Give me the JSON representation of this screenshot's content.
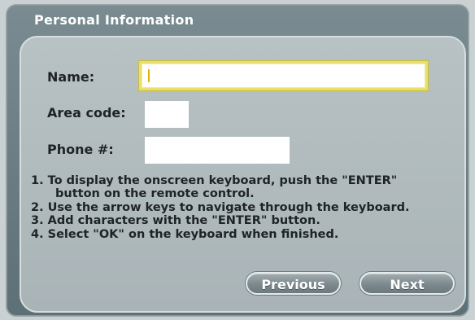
{
  "dialog": {
    "title": "Personal Information"
  },
  "form": {
    "name_label": "Name:",
    "name_value": "",
    "area_label": "Area code:",
    "area_value": "",
    "phone_label": "Phone #:",
    "phone_value": ""
  },
  "instructions": [
    "1. To display the onscreen keyboard, push the \"ENTER\"",
    "button on the remote control.",
    "2. Use the arrow keys to navigate through the keyboard.",
    "3. Add characters with the \"ENTER\" button.",
    "4. Select \"OK\" on the keyboard when finished."
  ],
  "buttons": {
    "previous": "Previous",
    "next": "Next"
  },
  "colors": {
    "focus_border": "#e8e06a",
    "caret": "#e0b400"
  }
}
